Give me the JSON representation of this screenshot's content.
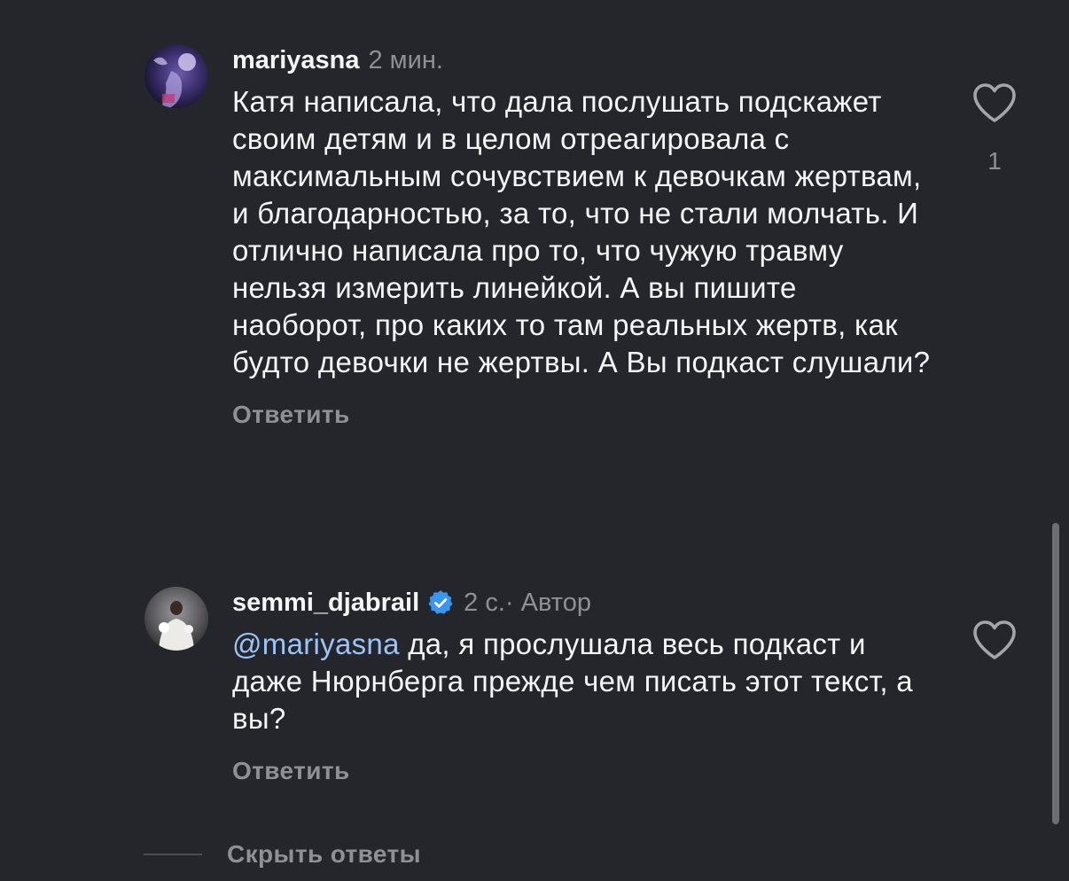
{
  "comments": [
    {
      "username": "mariyasna",
      "time": "2 мин.",
      "text": "Катя написала, что дала послушать подскажет своим детям и в целом отреагировала с максимальным сочувствием к девочкам жертвам, и благодарностью, за то, что не стали молчать. И отлично написала про то, что чужую травму нельзя измерить линейкой. А вы пишите наоборот, про каких то там реальных жертв, как будто девочки не жертвы. А Вы подкаст слушали?",
      "reply_label": "Ответить",
      "like_count": "1",
      "avatar_icon": "avatar-image"
    },
    {
      "username": "semmi_djabrail",
      "verified_icon": "verified-badge-icon",
      "time": "2 с.",
      "author_label": " · Автор",
      "mention": "@mariyasna",
      "text": " да, я прослушала весь подкаст и даже Нюрнберга прежде чем писать этот текст, а вы?",
      "reply_label": "Ответить",
      "avatar_icon": "avatar-image"
    }
  ],
  "hide_replies_label": "Скрыть ответы",
  "colors": {
    "background": "#24262b",
    "muted_text": "#8e9096",
    "mention": "#9ac4f8",
    "verified": "#3897f0"
  }
}
